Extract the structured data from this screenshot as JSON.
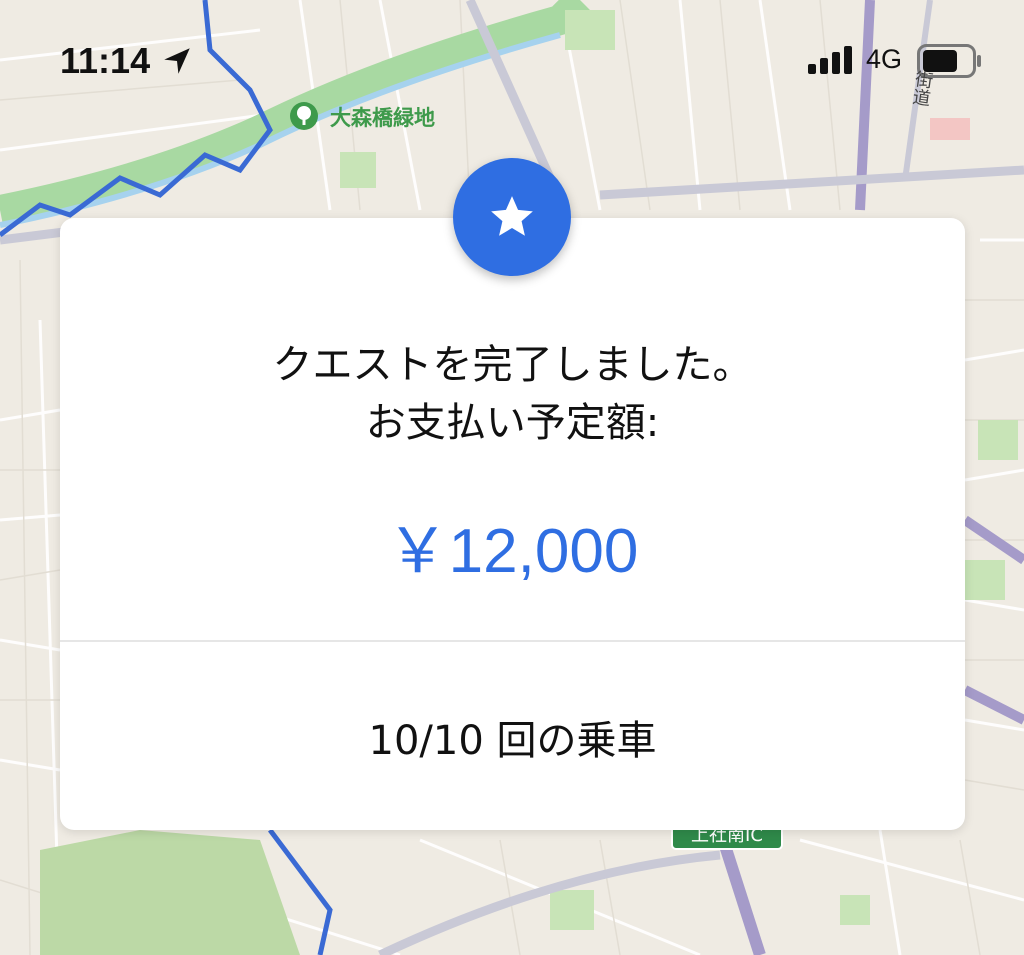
{
  "status_bar": {
    "time": "11:14",
    "network": "4G",
    "icons": [
      "location-arrow-icon",
      "cellular-signal-icon",
      "battery-icon"
    ]
  },
  "map": {
    "park_label": "大森橋緑地",
    "road_label": "街道",
    "ic_label": "上社南IC",
    "icons": [
      "park-tree-icon"
    ]
  },
  "dialog": {
    "title_line1": "クエストを完了しました。",
    "title_line2": "お支払い予定額:",
    "amount": "￥12,000",
    "rides": "10/10 回の乗車",
    "icon": "star-icon",
    "accent_color": "#2f6ee2"
  }
}
